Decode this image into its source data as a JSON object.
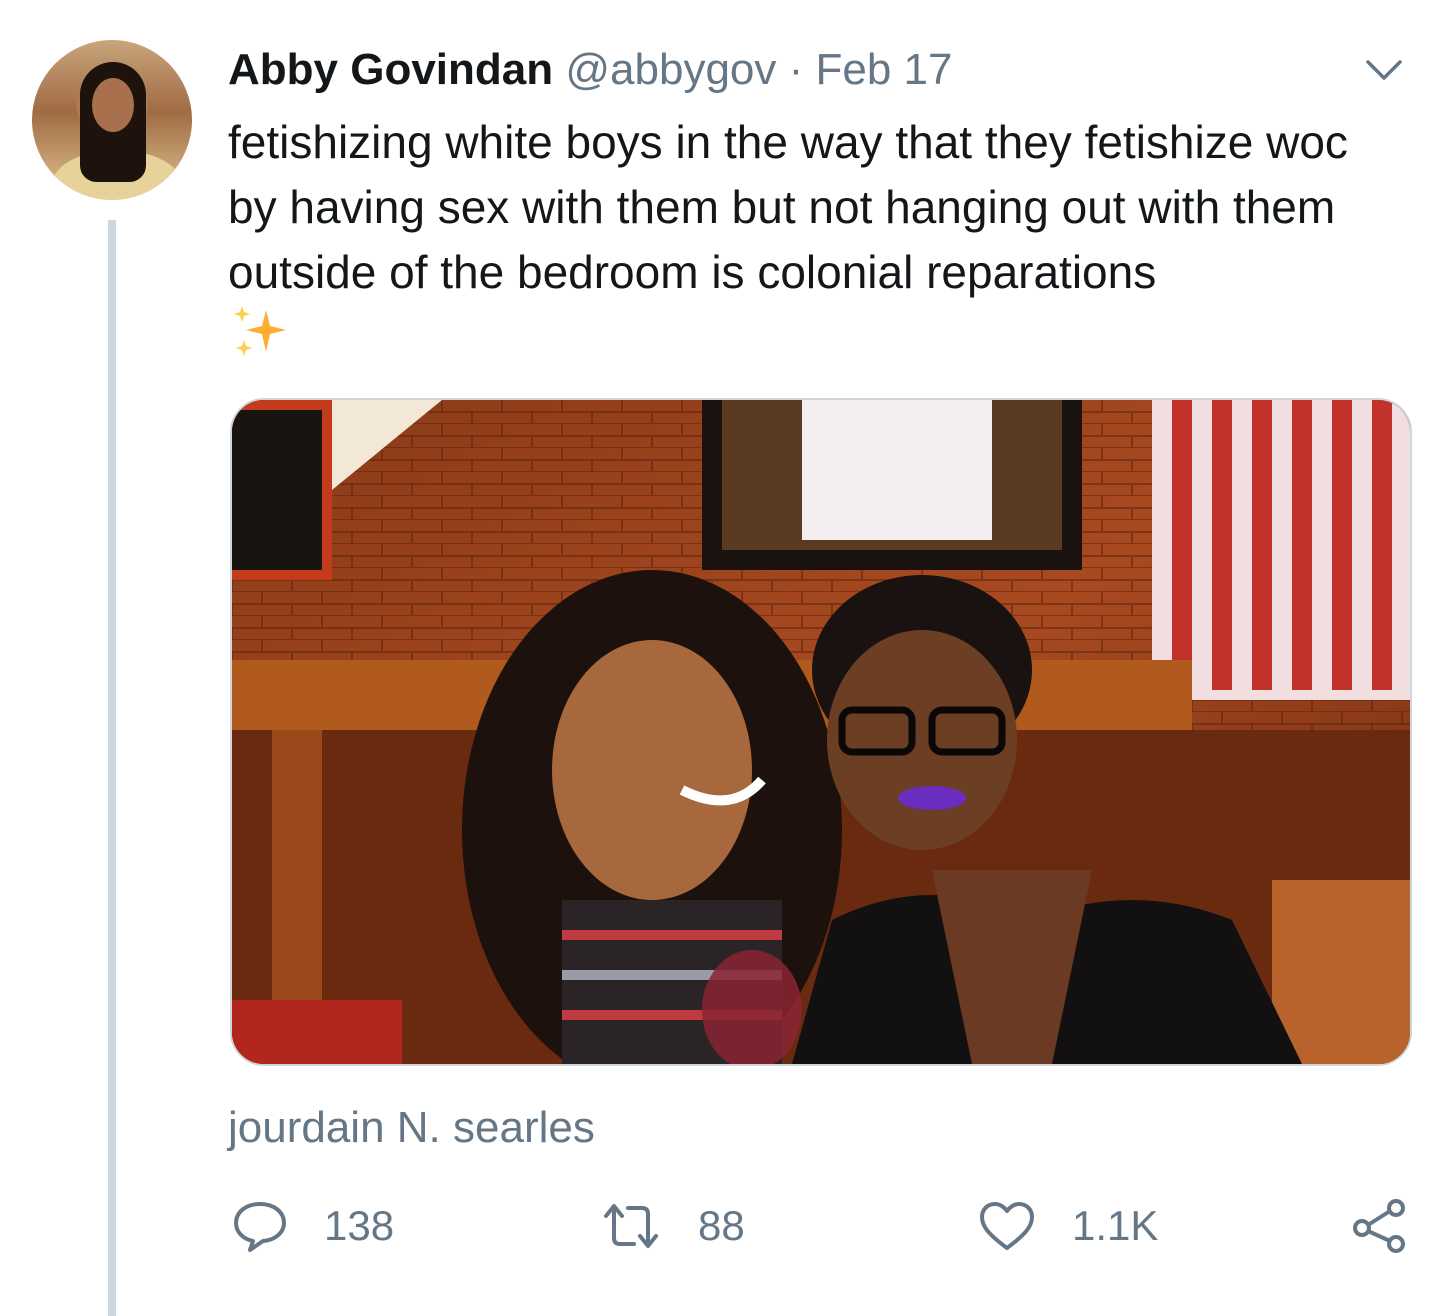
{
  "author": {
    "name": "Abby Govindan",
    "handle": "@abbygov",
    "separator": "·",
    "date": "Feb 17"
  },
  "tweet": {
    "text": "fetishizing white boys in the way that they fetishize woc by having sex with them but not hanging out with them outside of the bedroom is colonial reparations",
    "emoji": "sparkles-icon"
  },
  "media": {
    "attribution": "jourdain N. searles"
  },
  "actions": {
    "reply_count": "138",
    "retweet_count": "88",
    "like_count": "1.1K"
  },
  "colors": {
    "text_primary": "#14171a",
    "text_secondary": "#657786",
    "thread_line": "#ccd6dd",
    "sparkle": "#ffac33"
  }
}
